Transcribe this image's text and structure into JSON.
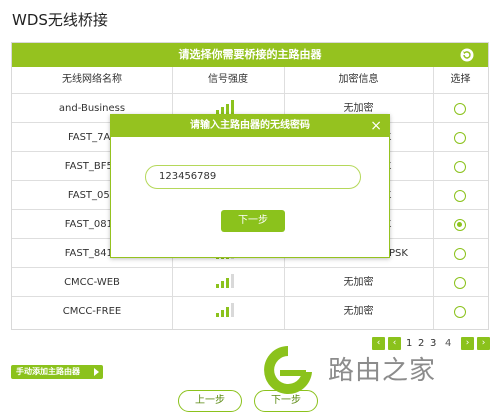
{
  "page": {
    "title": "WDS无线桥接"
  },
  "table": {
    "header_title": "请选择你需要桥接的主路由器",
    "columns": [
      "无线网络名称",
      "信号强度",
      "加密信息",
      "选择"
    ],
    "rows": [
      {
        "ssid": "and-Business",
        "signal_bars": 4,
        "encryption": "无加密",
        "selected": false
      },
      {
        "ssid": "FAST_7AF",
        "signal_bars": 4,
        "encryption": "K",
        "selected": false
      },
      {
        "ssid": "FAST_BF50",
        "signal_bars": 4,
        "encryption": "K",
        "selected": false
      },
      {
        "ssid": "FAST_050",
        "signal_bars": 4,
        "encryption": "K",
        "selected": false
      },
      {
        "ssid": "FAST_0817",
        "signal_bars": 4,
        "encryption": "K",
        "selected": true
      },
      {
        "ssid": "FAST_8419",
        "signal_bars": 3,
        "encryption": "WPA-PSK/WPA2-PSK",
        "selected": false
      },
      {
        "ssid": "CMCC-WEB",
        "signal_bars": 3,
        "encryption": "无加密",
        "selected": false
      },
      {
        "ssid": "CMCC-FREE",
        "signal_bars": 3,
        "encryption": "无加密",
        "selected": false
      }
    ]
  },
  "pager": {
    "first": "‹",
    "prev": "‹",
    "pages": [
      "1",
      "2",
      "3",
      "4"
    ],
    "current": "4",
    "next": "›",
    "last": "›"
  },
  "actions": {
    "add_router": "手动添加主路由器",
    "prev_step": "上一步",
    "next_step": "下一步"
  },
  "modal": {
    "title": "请输入主路由器的无线密码",
    "close": "×",
    "password_value": "123456789",
    "next_step": "下一步"
  },
  "watermark": {
    "text": "路由之家"
  },
  "colors": {
    "accent": "#8bc21c",
    "header": "#95c21f"
  }
}
